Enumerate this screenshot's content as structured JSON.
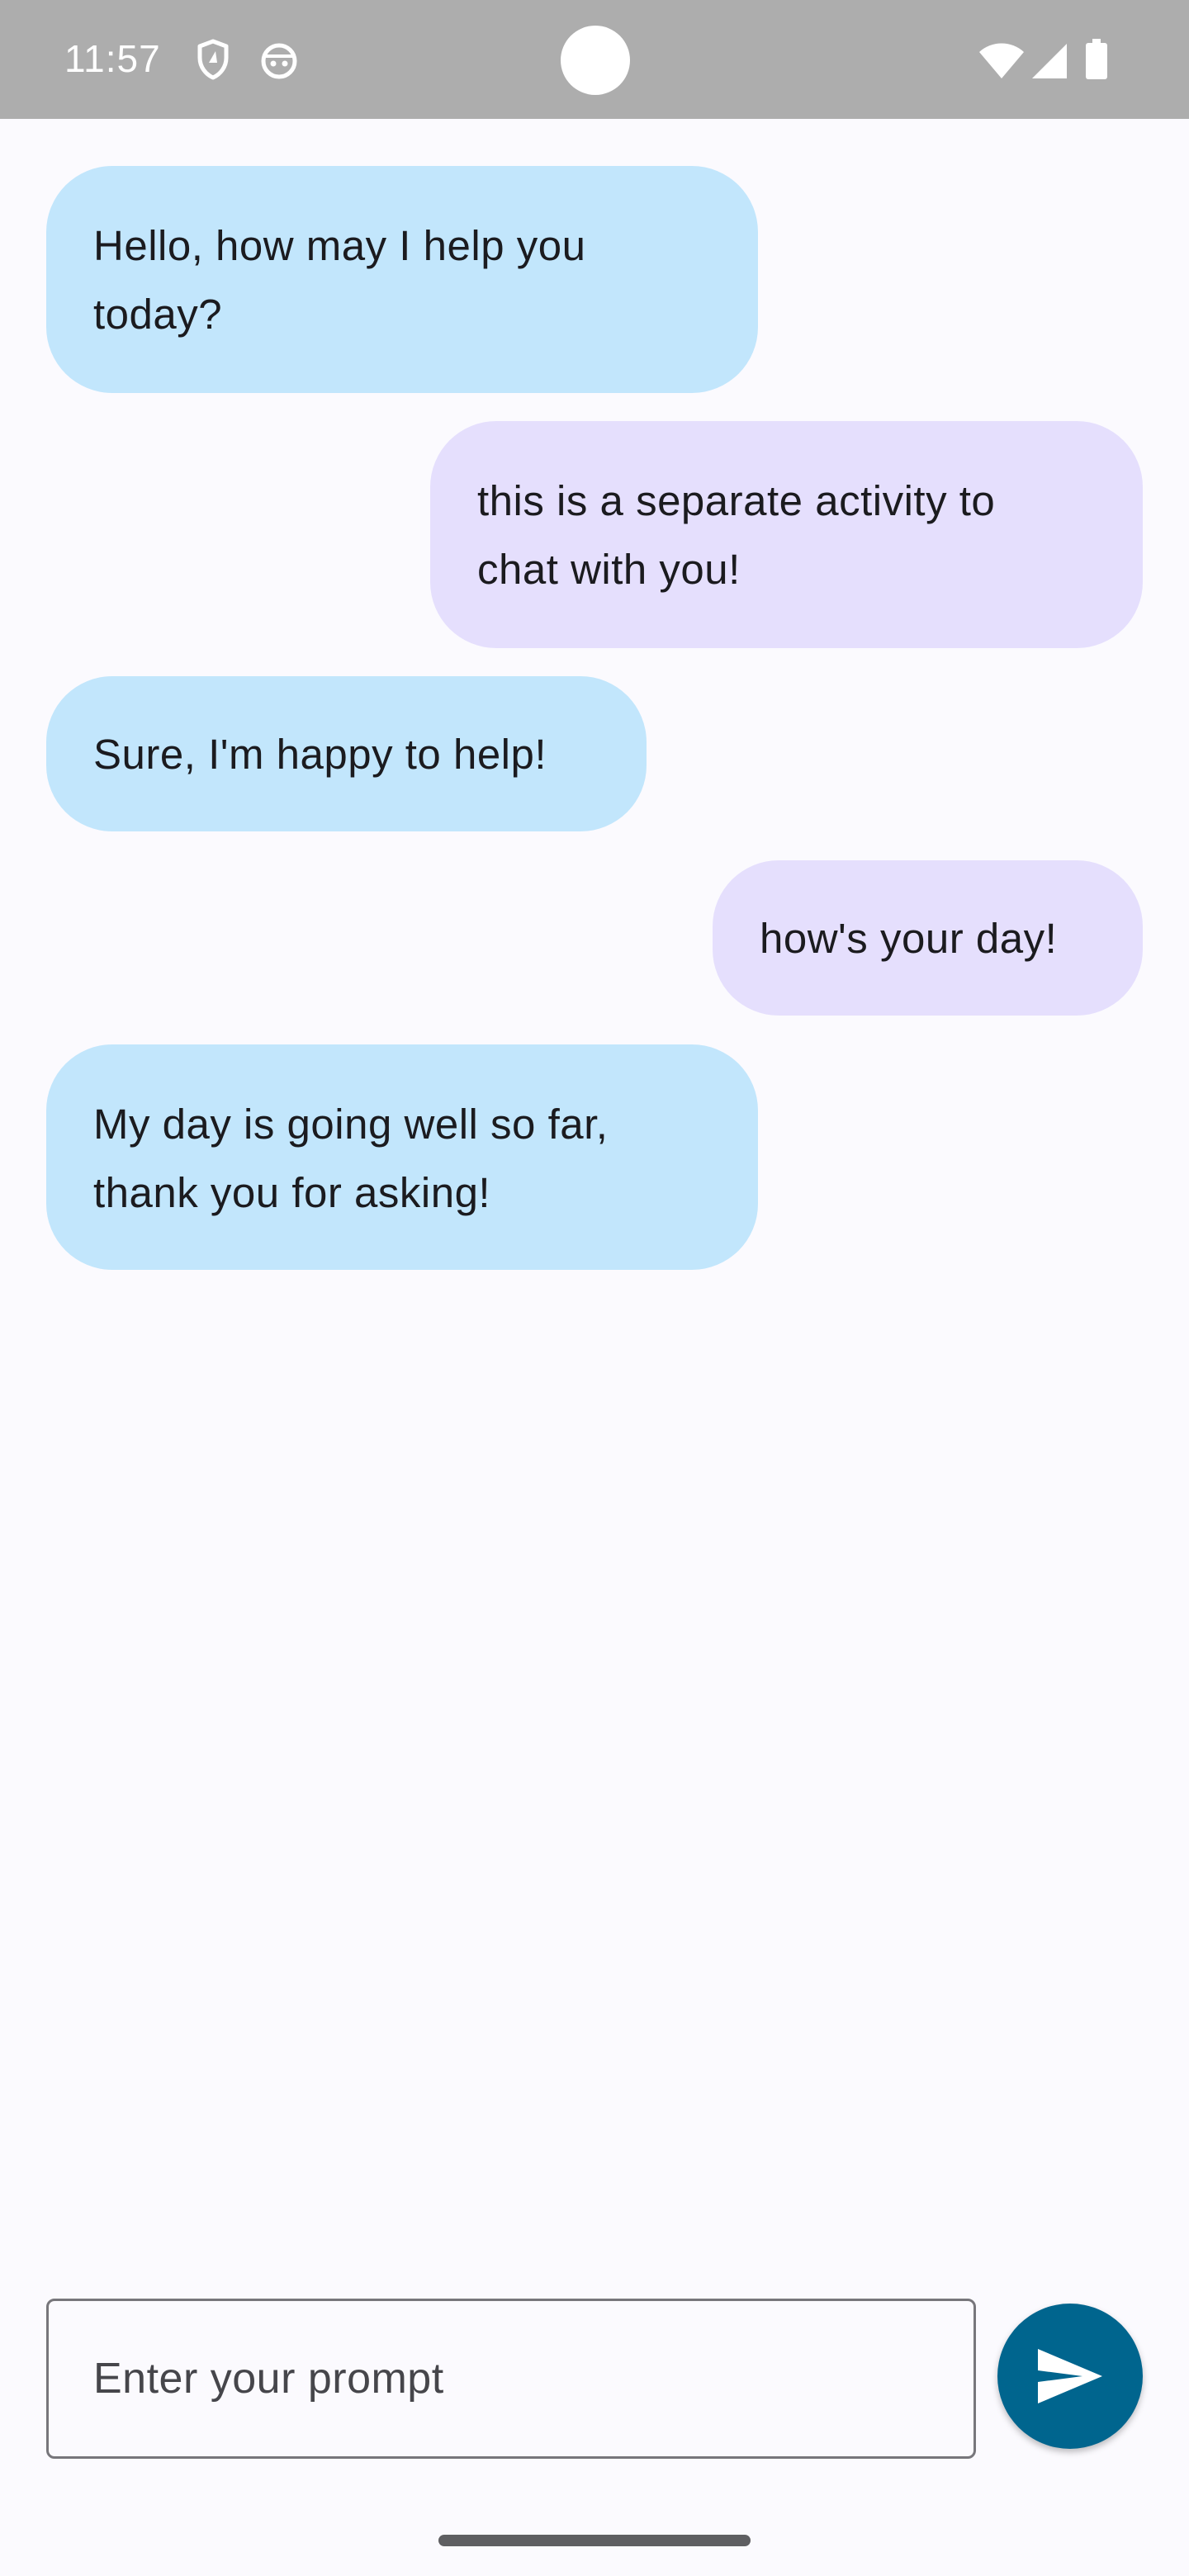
{
  "status_bar": {
    "time": "11:57",
    "left_icons": [
      "shield-icon",
      "android-face-icon"
    ],
    "right_icons": [
      "wifi-icon",
      "cellular-signal-icon",
      "battery-icon"
    ]
  },
  "colors": {
    "status_bar": "#adadad",
    "background": "#fbfafe",
    "model_bubble": "#c2e6fc",
    "user_bubble": "#e5dffd",
    "send_button": "#00658e"
  },
  "messages": [
    {
      "sender": "model",
      "line1": "Hello, how may I help you",
      "line2": "today?"
    },
    {
      "sender": "user",
      "line1": "this is a separate activity to",
      "line2": "chat with you!"
    },
    {
      "sender": "model",
      "line1": "Sure, I'm happy to help!"
    },
    {
      "sender": "user",
      "line1": "how's your day!"
    },
    {
      "sender": "model",
      "line1": "My day is going well so far,",
      "line2": "thank you for asking!"
    }
  ],
  "input": {
    "placeholder": "Enter your prompt",
    "value": ""
  },
  "send_button": {
    "icon": "send-icon"
  }
}
